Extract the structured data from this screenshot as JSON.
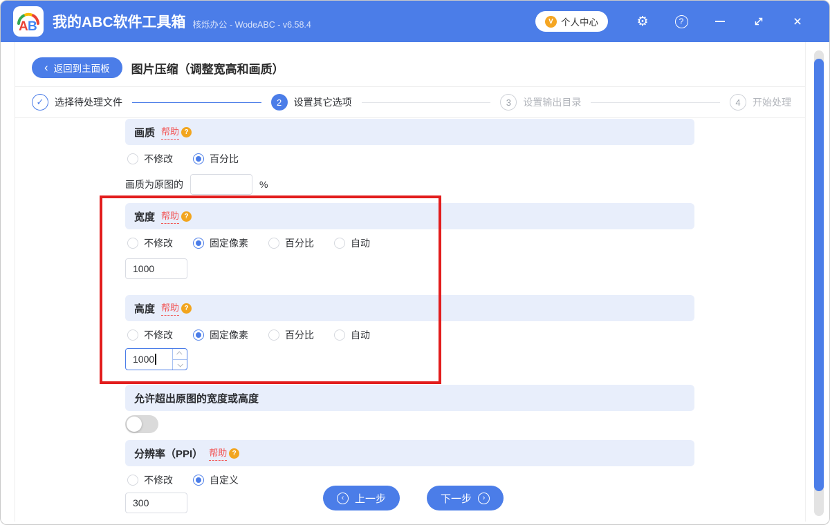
{
  "colors": {
    "accent_blue": "#4b7de8",
    "section_bar_bg": "#e8eefb",
    "help_red": "#f25555",
    "badge_orange": "#f2a51e",
    "annotation_red": "#e21d1d"
  },
  "titlebar": {
    "app_title": "我的ABC软件工具箱",
    "app_subtitle": "核烁办公 - WodeABC - v6.58.4",
    "logo_letter_a": "A",
    "logo_letter_b": "B",
    "user_center_label": "个人中心",
    "vip_badge": "V"
  },
  "icons": {
    "gear": "⚙",
    "help_question": "?",
    "close": "×",
    "back_chevron": "‹",
    "prev_chevron": "‹",
    "next_chevron": "›",
    "check": "✓",
    "help_badge": "?"
  },
  "header": {
    "back_label": "返回到主面板",
    "page_title": "图片压缩（调整宽高和画质）"
  },
  "steps": [
    {
      "state": "done",
      "label": "选择待处理文件"
    },
    {
      "state": "active",
      "number": "2",
      "label": "设置其它选项"
    },
    {
      "state": "pending",
      "number": "3",
      "label": "设置输出目录"
    },
    {
      "state": "pending",
      "number": "4",
      "label": "开始处理"
    }
  ],
  "sections": {
    "quality": {
      "title": "画质",
      "help_label": "帮助",
      "options": [
        "不修改",
        "百分比"
      ],
      "selected_index": 1,
      "input_label": "画质为原图的",
      "input_value": "",
      "unit": "%"
    },
    "width": {
      "title": "宽度",
      "help_label": "帮助",
      "options": [
        "不修改",
        "固定像素",
        "百分比",
        "自动"
      ],
      "selected_index": 1,
      "value": "1000"
    },
    "height": {
      "title": "高度",
      "help_label": "帮助",
      "options": [
        "不修改",
        "固定像素",
        "百分比",
        "自动"
      ],
      "selected_index": 1,
      "value": "1000",
      "focused": true
    },
    "overflow": {
      "title": "允许超出原图的宽度或高度",
      "toggle_state": "off"
    },
    "resolution": {
      "title": "分辨率（PPI）",
      "help_label": "帮助",
      "options": [
        "不修改",
        "自定义"
      ],
      "selected_index": 1,
      "value": "300"
    }
  },
  "footer": {
    "prev_label": "上一步",
    "next_label": "下一步"
  },
  "annotation": {
    "type": "red-rectangle-highlight"
  }
}
